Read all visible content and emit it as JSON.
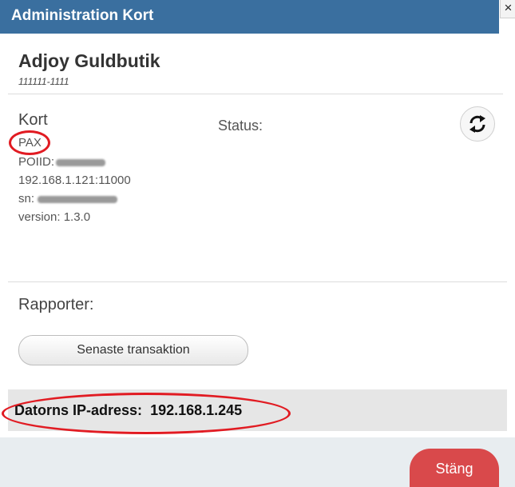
{
  "window": {
    "title": "Administration Kort",
    "close_glyph": "×"
  },
  "store": {
    "name": "Adjoy Guldbutik",
    "id": "111111-1111"
  },
  "card": {
    "heading": "Kort",
    "type": "PAX",
    "poiid_label": "POIID:",
    "address": "192.168.1.121:11000",
    "sn_label": "sn:",
    "version": "version: 1.3.0",
    "status_label": "Status:"
  },
  "reports": {
    "heading": "Rapporter:",
    "latest_transaction_label": "Senaste transaktion"
  },
  "ip": {
    "label": "Datorns IP-adress:",
    "value": "192.168.1.245"
  },
  "footer": {
    "close_label": "Stäng"
  },
  "icons": {
    "refresh": "refresh-icon",
    "close": "close-icon"
  },
  "colors": {
    "titlebar": "#3a6f9f",
    "close_button": "#d9494b",
    "annotation": "#e11b22"
  }
}
